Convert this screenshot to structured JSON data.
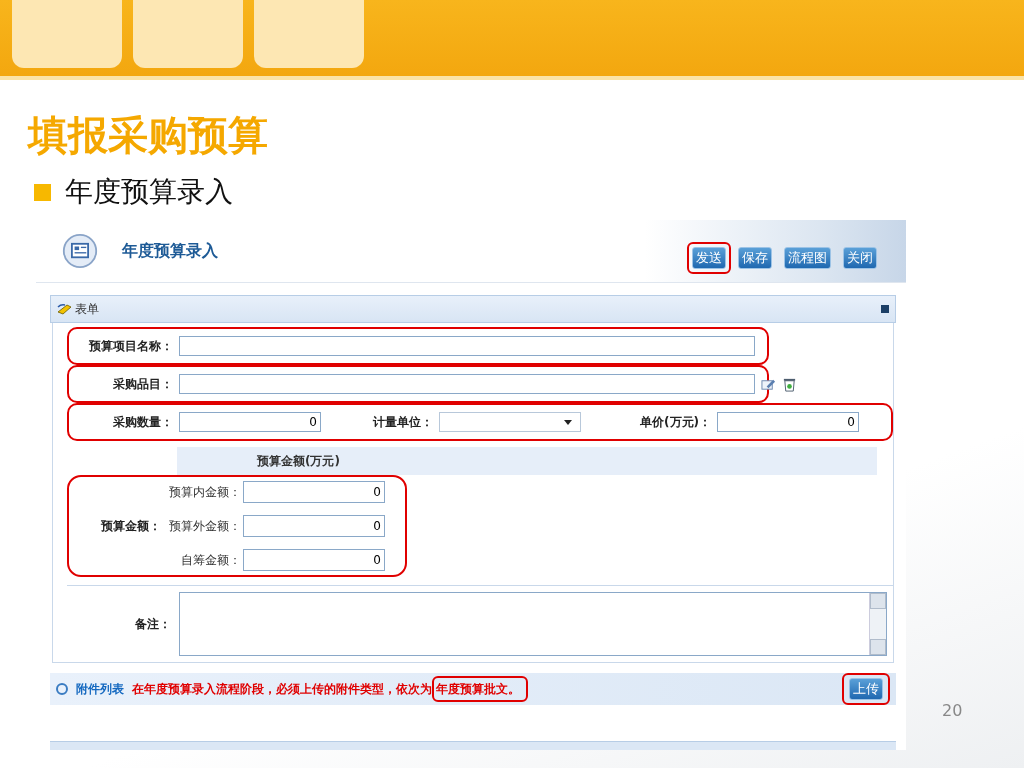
{
  "slide": {
    "title": "填报采购预算",
    "bullet": "年度预算录入",
    "page_number": "20"
  },
  "window": {
    "title": "年度预算录入",
    "buttons": [
      {
        "label": "发送",
        "highlighted": true
      },
      {
        "label": "保存",
        "highlighted": false
      },
      {
        "label": "流程图",
        "highlighted": false
      },
      {
        "label": "关闭",
        "highlighted": false
      }
    ]
  },
  "section": {
    "title": "表单"
  },
  "form": {
    "name_row": {
      "label": "预算项目名称：",
      "highlighted": true
    },
    "category_row": {
      "label": "采购品目：",
      "highlighted": true
    },
    "quantity_row": {
      "highlighted": true,
      "quantity_label": "采购数量：",
      "quantity": "0",
      "unit_label": "计量单位：",
      "price_label": "单价(万元)：",
      "price": "0"
    },
    "budget": {
      "header": "预算金额(万元)",
      "label": "预算金额：",
      "highlighted": true,
      "items": [
        {
          "label": "预算内金额：",
          "value": "0"
        },
        {
          "label": "预算外金额：",
          "value": "0"
        },
        {
          "label": "自筹金额：",
          "value": "0"
        }
      ]
    },
    "notes": {
      "label": "备注："
    }
  },
  "attachments": {
    "title": "附件列表",
    "notice": "在年度预算录入流程阶段，必须上传的附件类型，依次为",
    "notice_emphasis": "年度预算批文。",
    "emphasis_highlighted": true,
    "upload_button": {
      "label": "上传",
      "highlighted": true
    }
  }
}
